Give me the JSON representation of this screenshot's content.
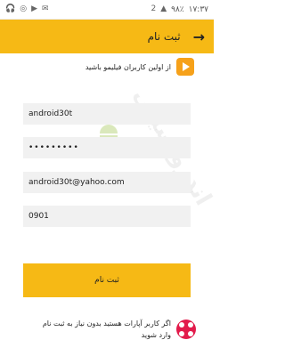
{
  "status_bar": {
    "time": "۱۷:۳۷",
    "battery": "۹۸٪"
  },
  "appbar": {
    "title": "ثبت نام",
    "back_icon": "arrow-right-icon"
  },
  "promo": {
    "text": "از اولین کاربران فیلیمو باشید",
    "logo_icon": "filimo-play-icon"
  },
  "form": {
    "username_value": "android30t",
    "password_value": "•••••••••",
    "email_value": "android30t@yahoo.com",
    "phone_value": "0901"
  },
  "submit_label": "ثبت نام",
  "footer": {
    "text": "اگر کاربر آپارات هستید بدون نیاز به ثبت نام وارد شوید",
    "logo_icon": "aparat-icon"
  },
  "watermark": "اندرو سیتی"
}
